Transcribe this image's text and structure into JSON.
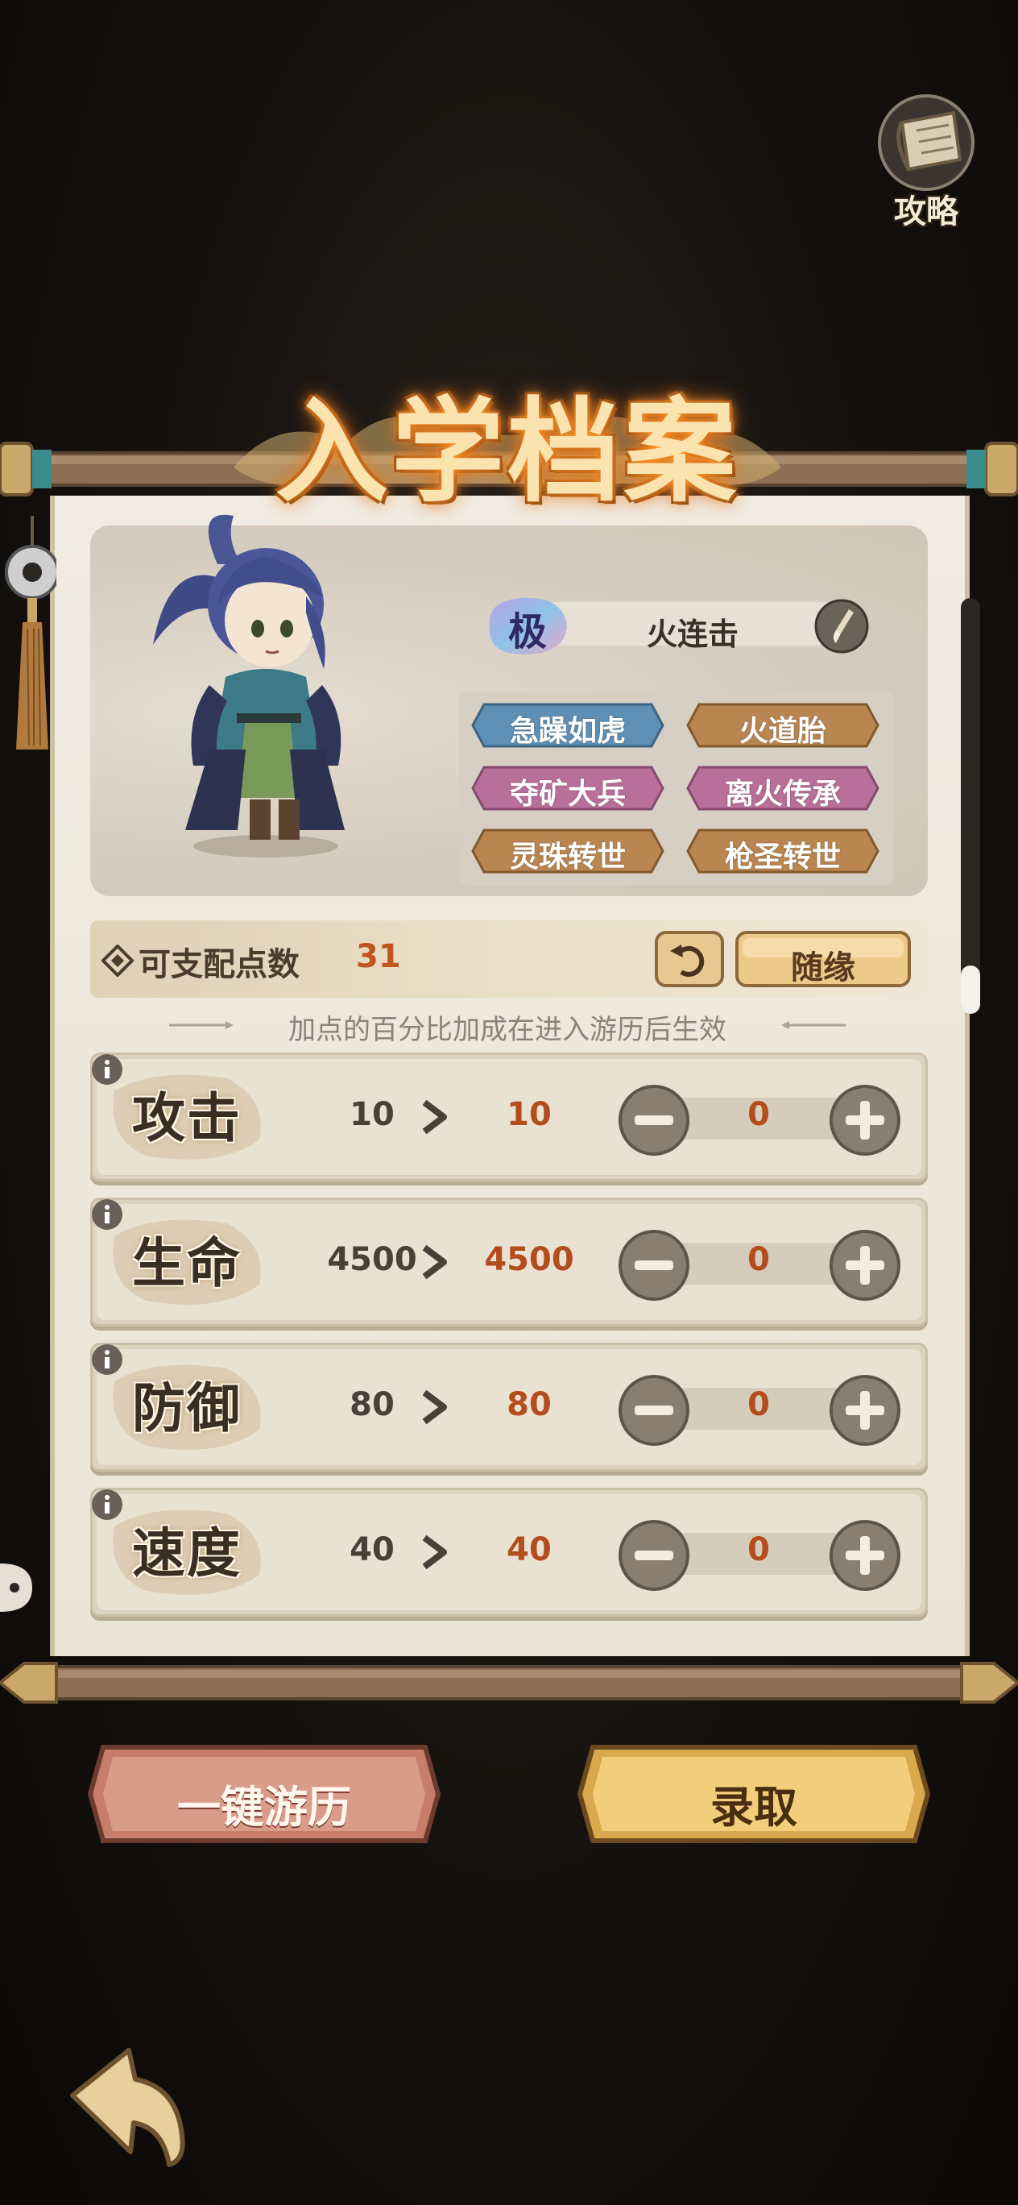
{
  "guide": {
    "label": "攻略"
  },
  "title": "入学档案",
  "profile": {
    "grade": "极",
    "skill_name": "火连击",
    "traits": [
      {
        "label": "急躁如虎",
        "color": "#5f8fb4"
      },
      {
        "label": "火道胎",
        "color": "#b98652"
      },
      {
        "label": "夺矿大兵",
        "color": "#b86f9a"
      },
      {
        "label": "离火传承",
        "color": "#b86f9a"
      },
      {
        "label": "灵珠转世",
        "color": "#b98652"
      },
      {
        "label": "枪圣转世",
        "color": "#b98652"
      }
    ]
  },
  "points": {
    "label": "可支配点数",
    "value": "31",
    "random_label": "随缘"
  },
  "note": "加点的百分比加成在进入游历后生效",
  "stats": [
    {
      "name": "攻击",
      "base": "10",
      "new": "10",
      "added": "0"
    },
    {
      "name": "生命",
      "base": "4500",
      "new": "4500",
      "added": "0"
    },
    {
      "name": "防御",
      "base": "80",
      "new": "80",
      "added": "0"
    },
    {
      "name": "速度",
      "base": "40",
      "new": "40",
      "added": "0"
    }
  ],
  "buttons": {
    "explore": "一键游历",
    "enroll": "录取"
  },
  "colors": {
    "accent_orange": "#b44d1c",
    "paper": "#ebe4d6",
    "wood": "#8a6a50"
  }
}
